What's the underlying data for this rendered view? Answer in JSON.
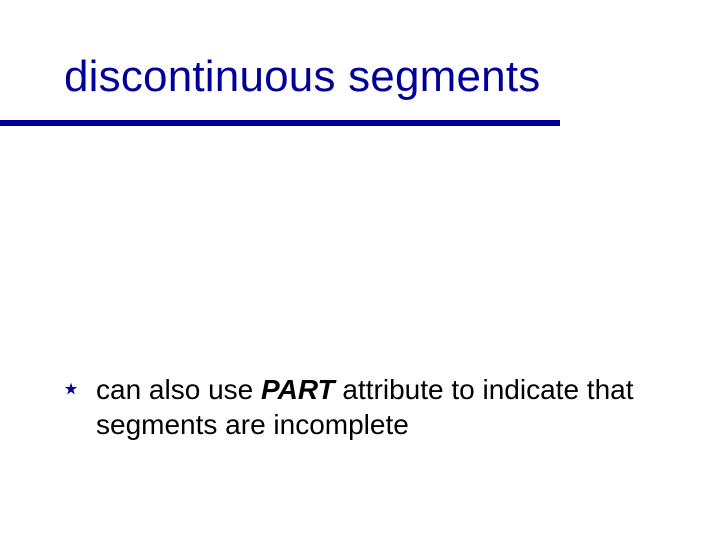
{
  "title": "discontinuous segments",
  "bullet": {
    "pre": "can also use ",
    "emph": "PART",
    "post": " attribute to indicate that segments are incomplete"
  },
  "colors": {
    "accent": "#000099"
  }
}
